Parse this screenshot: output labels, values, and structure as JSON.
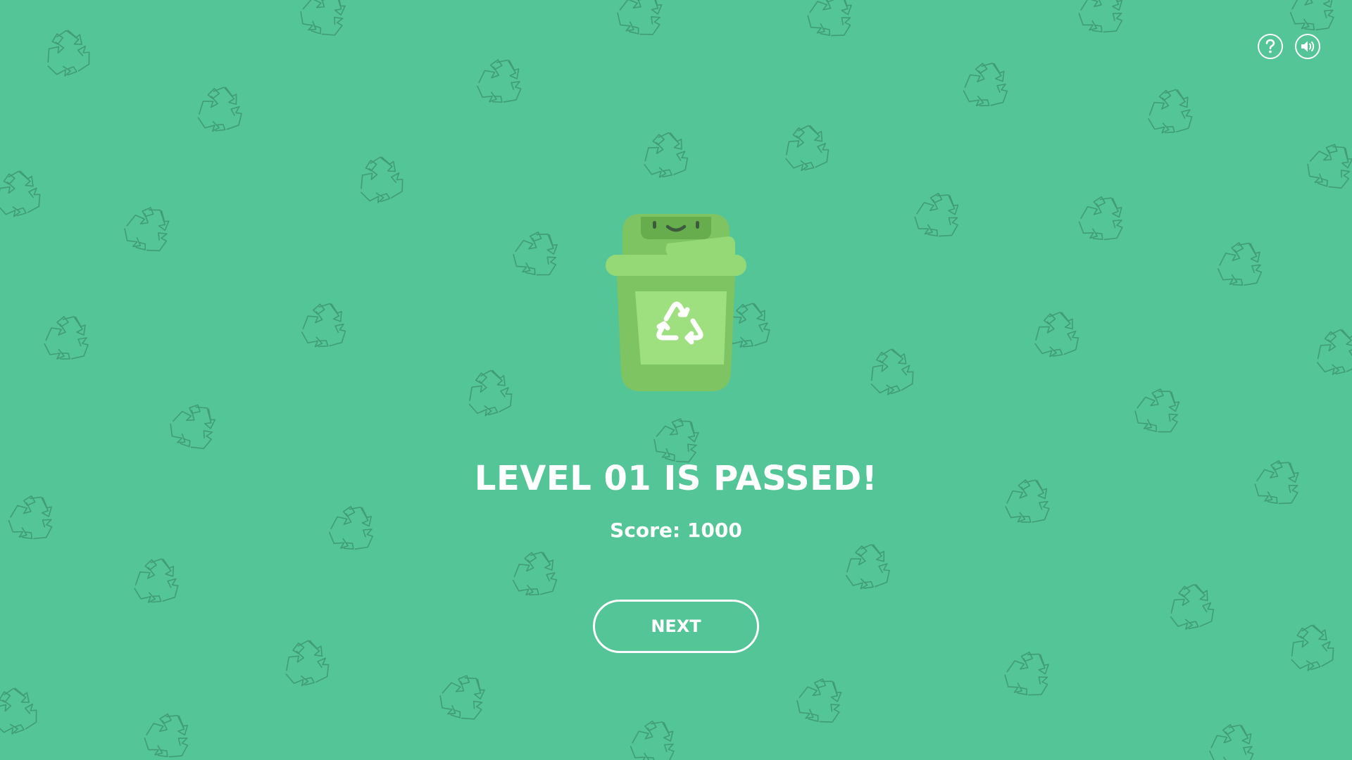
{
  "game": {
    "title": "LEVEL 01 IS PASSED!",
    "score": "Score: 1000",
    "next_label": "NEXT"
  },
  "toolbar": {
    "help_glyph": "?",
    "help_icon": "question-mark-icon",
    "sound_icon": "speaker-on-icon"
  },
  "mascot": {
    "icon": "recycle-bin-mascot-icon",
    "emblem": "recycle-icon"
  },
  "colors": {
    "background": "#54c596",
    "pattern": "#3d9670",
    "bin_body": "#7fc463",
    "bin_lid": "#95d976",
    "bin_panel": "#9ee07f",
    "text": "#ffffff"
  }
}
